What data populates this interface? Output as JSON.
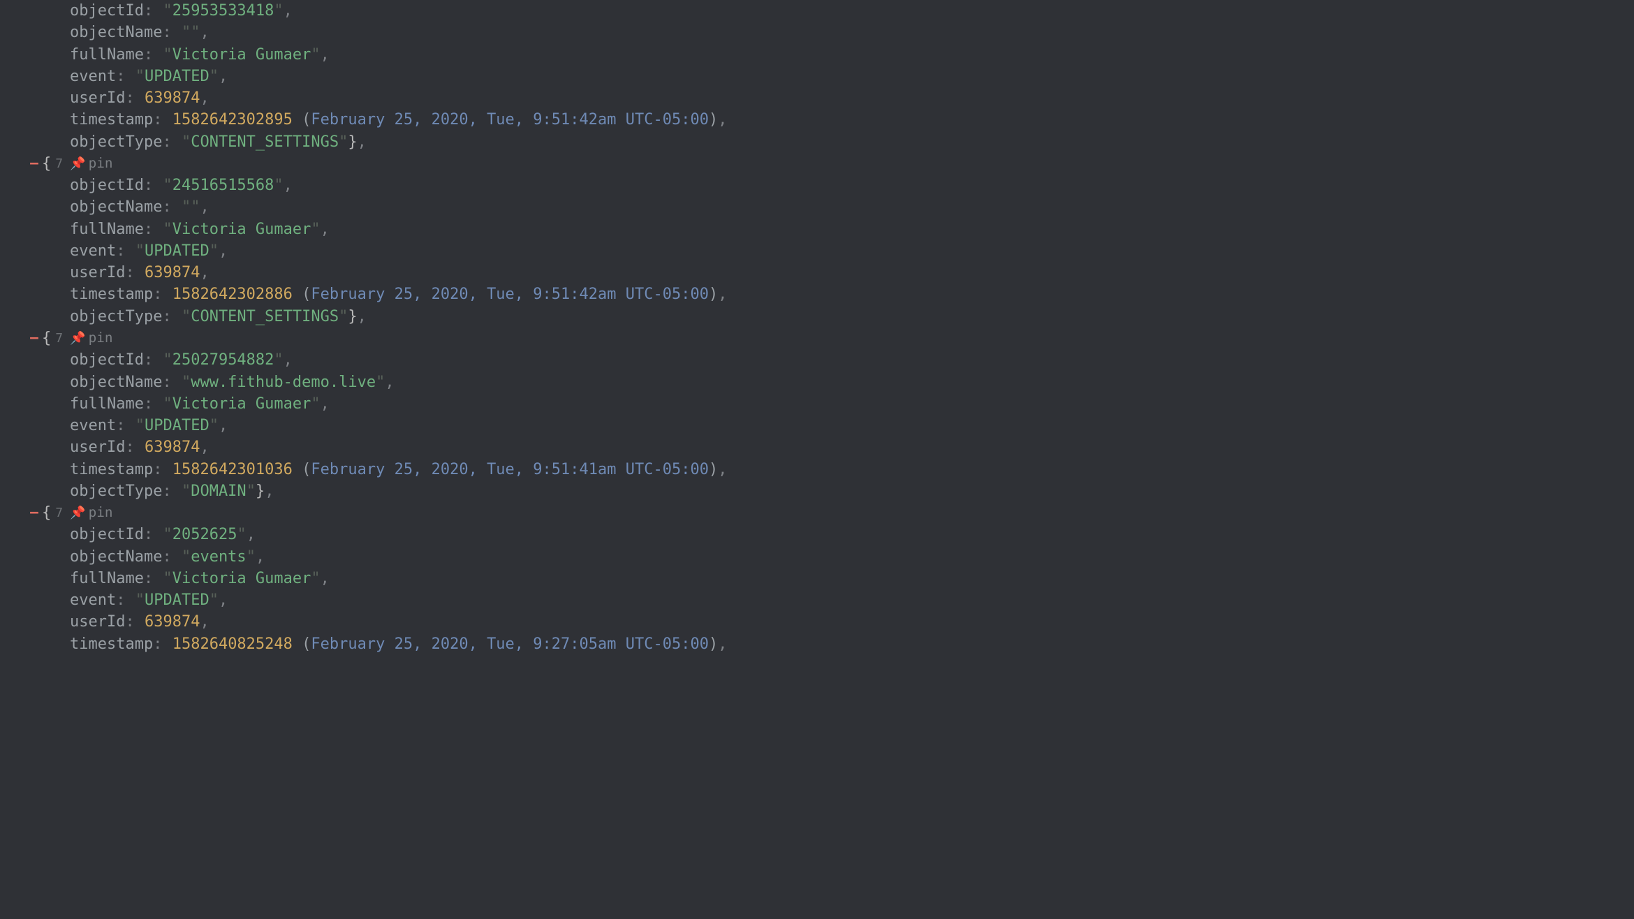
{
  "labels": {
    "objectId": "objectId",
    "objectName": "objectName",
    "fullName": "fullName",
    "event": "event",
    "userId": "userId",
    "timestamp": "timestamp",
    "objectType": "objectType",
    "pin": "pin",
    "count": "7"
  },
  "entries": [
    {
      "showOpen": false,
      "objectId": "25953533418",
      "objectName": "",
      "fullName": "Victoria Gumaer",
      "event": "UPDATED",
      "userId": "639874",
      "timestamp": "1582642302895",
      "timestampLabel": "February 25, 2020, Tue, 9:51:42am UTC-05:00",
      "objectType": "CONTENT_SETTINGS",
      "showClose": true
    },
    {
      "showOpen": true,
      "objectId": "24516515568",
      "objectName": "",
      "fullName": "Victoria Gumaer",
      "event": "UPDATED",
      "userId": "639874",
      "timestamp": "1582642302886",
      "timestampLabel": "February 25, 2020, Tue, 9:51:42am UTC-05:00",
      "objectType": "CONTENT_SETTINGS",
      "showClose": true
    },
    {
      "showOpen": true,
      "objectId": "25027954882",
      "objectName": "www.fithub-demo.live",
      "fullName": "Victoria Gumaer",
      "event": "UPDATED",
      "userId": "639874",
      "timestamp": "1582642301036",
      "timestampLabel": "February 25, 2020, Tue, 9:51:41am UTC-05:00",
      "objectType": "DOMAIN",
      "showClose": true
    },
    {
      "showOpen": true,
      "objectId": "2052625",
      "objectName": "events",
      "fullName": "Victoria Gumaer",
      "event": "UPDATED",
      "userId": "639874",
      "timestamp": "1582640825248",
      "timestampLabel": "February 25, 2020, Tue, 9:27:05am UTC-05:00",
      "objectType": null,
      "showClose": false
    }
  ]
}
